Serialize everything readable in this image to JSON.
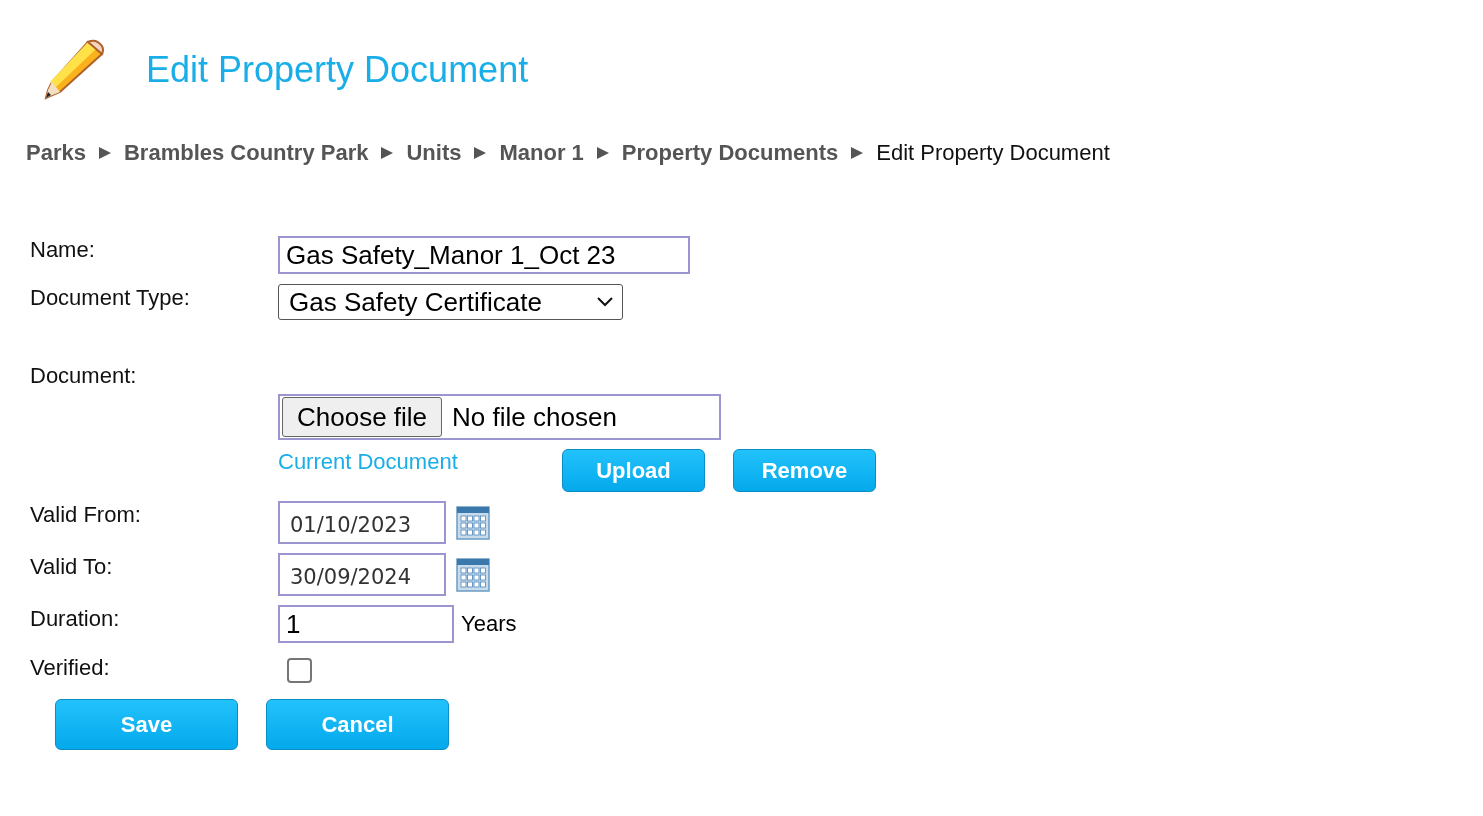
{
  "header": {
    "title": "Edit Property Document"
  },
  "breadcrumb": [
    {
      "label": "Parks",
      "current": false
    },
    {
      "label": "Brambles Country Park",
      "current": false
    },
    {
      "label": "Units",
      "current": false
    },
    {
      "label": "Manor 1",
      "current": false
    },
    {
      "label": "Property Documents",
      "current": false
    },
    {
      "label": "Edit Property Document",
      "current": true
    }
  ],
  "form": {
    "fields": [
      {
        "kind": "text",
        "label": "Name:",
        "value": "Gas Safety_Manor 1_Oct 23"
      },
      {
        "kind": "select",
        "label": "Document Type:",
        "value": "Gas Safety Certificate"
      },
      {
        "kind": "file",
        "label": "Document:",
        "button": "Choose file",
        "status": "No file chosen",
        "link": "Current Document",
        "actions": [
          "Upload",
          "Remove"
        ]
      },
      {
        "kind": "date",
        "label": "Valid From:",
        "value": "01/10/2023"
      },
      {
        "kind": "date",
        "label": "Valid To:",
        "value": "30/09/2024"
      },
      {
        "kind": "number",
        "label": "Duration:",
        "value": "1",
        "unit": "Years"
      },
      {
        "kind": "checkbox",
        "label": "Verified:",
        "checked": false
      }
    ]
  },
  "buttons": [
    "Save",
    "Cancel"
  ]
}
